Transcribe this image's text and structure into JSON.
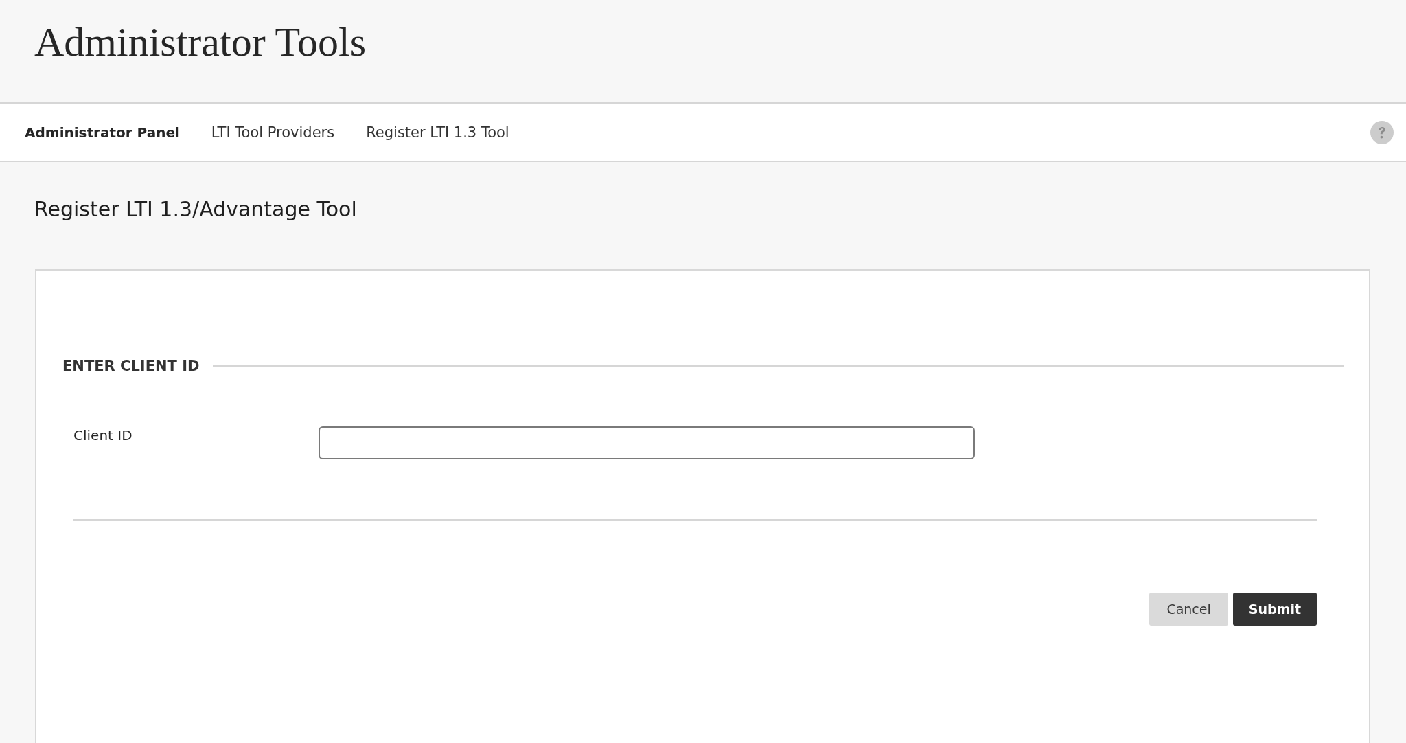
{
  "header": {
    "title": "Administrator Tools"
  },
  "breadcrumbs": [
    {
      "label": "Administrator Panel",
      "emphasized": true
    },
    {
      "label": "LTI Tool Providers",
      "emphasized": false
    },
    {
      "label": "Register LTI 1.3 Tool",
      "emphasized": false
    }
  ],
  "page_title": "Register LTI 1.3/Advantage Tool",
  "form": {
    "section_title": "ENTER CLIENT ID",
    "fields": [
      {
        "label": "Client ID"
      }
    ],
    "buttons": [
      {
        "label": "Cancel",
        "kind": "secondary"
      },
      {
        "label": "Submit",
        "kind": "primary"
      }
    ]
  }
}
